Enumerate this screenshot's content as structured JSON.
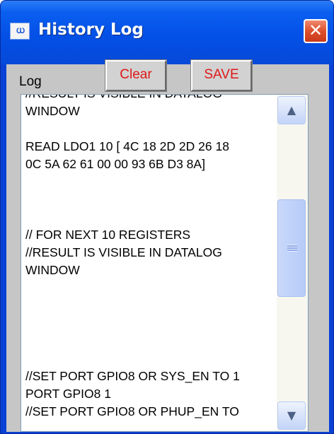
{
  "window": {
    "title": "History Log",
    "icon_text": "ധ",
    "close_glyph": "✕"
  },
  "toolbar": {
    "log_label": "Log",
    "clear_label": "Clear",
    "save_label": "SAVE"
  },
  "log": {
    "lines": [
      "//RESULT IS VISIBLE IN DATALOG",
      "WINDOW",
      "",
      "READ LDO1 10 [ 4C 18 2D 2D 26 18",
      "0C 5A 62 61 00 00 93 6B D3 8A]",
      "",
      "",
      "",
      "// FOR NEXT 10 REGISTERS",
      "//RESULT IS VISIBLE IN DATALOG",
      "WINDOW",
      "",
      "",
      "",
      "",
      "",
      "//SET PORT GPIO8 OR SYS_EN TO 1",
      "PORT GPIO8 1",
      "//SET PORT GPIO8 OR PHUP_EN TO"
    ]
  },
  "scrollbar": {
    "up_glyph": "▲",
    "down_glyph": "▼"
  },
  "colors": {
    "titlebar": "#0450e6",
    "client": "#c6c6c6",
    "button_text": "#e01818",
    "close_button": "#dd4f2c"
  }
}
